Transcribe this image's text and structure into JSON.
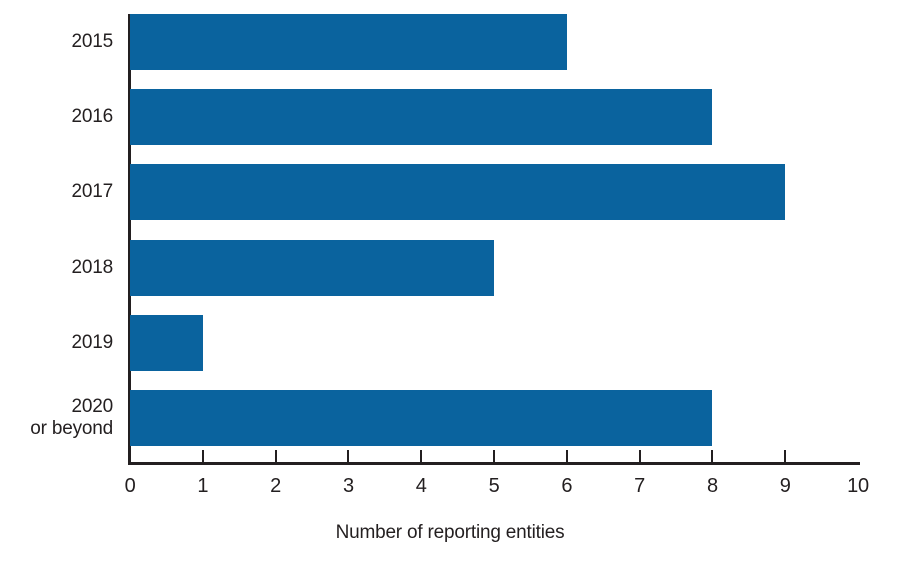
{
  "chart_data": {
    "type": "bar",
    "orientation": "horizontal",
    "title": "",
    "subtitle": "",
    "xlabel": "Number of reporting entities",
    "ylabel": "",
    "categories": [
      "2015",
      "2016",
      "2017",
      "2018",
      "2019",
      "2020\nor beyond"
    ],
    "values": [
      6,
      8,
      9,
      5,
      1,
      8
    ],
    "series": [
      {
        "name": "Number of reporting entities",
        "values": [
          6,
          8,
          9,
          5,
          1,
          8
        ]
      }
    ],
    "xlim": [
      0,
      10
    ],
    "xticks": [
      0,
      1,
      2,
      3,
      4,
      5,
      6,
      7,
      8,
      9,
      10
    ],
    "xtick_labels": [
      "0",
      "1",
      "2",
      "3",
      "4",
      "5",
      "6",
      "7",
      "8",
      "9",
      "10"
    ],
    "grid": false,
    "legend": false,
    "legend_position": "none",
    "bar_color": "#0a639e",
    "axis_color": "#231f20",
    "background_color": "#ffffff",
    "data_labels": false
  }
}
